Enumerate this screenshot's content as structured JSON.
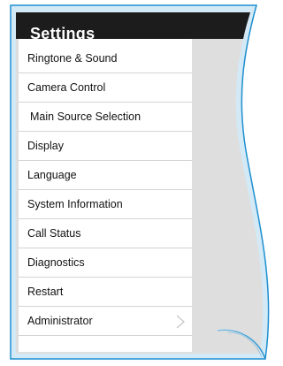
{
  "settings": {
    "title": "Settings",
    "items": [
      {
        "label": "Ringtone & Sound"
      },
      {
        "label": "Camera Control"
      },
      {
        "label": "Main Source Selection"
      },
      {
        "label": "Display"
      },
      {
        "label": "Language"
      },
      {
        "label": "System Information"
      },
      {
        "label": "Call Status"
      },
      {
        "label": "Diagnostics"
      },
      {
        "label": "Restart"
      },
      {
        "label": "Administrator",
        "icon": "chevron-right-icon"
      }
    ]
  },
  "colors": {
    "header_bg": "#1c1c1c",
    "panel_gray": "#dedede",
    "frame_blue": "#1e8fcf",
    "list_bg": "#ffffff"
  }
}
